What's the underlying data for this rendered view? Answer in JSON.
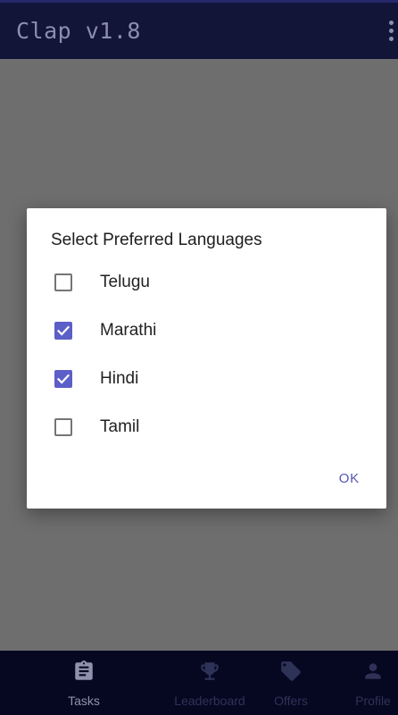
{
  "appbar": {
    "title": "Clap v1.8",
    "overflow_icon": "more-vert-icon"
  },
  "dialog": {
    "title": "Select Preferred Languages",
    "options": [
      {
        "label": "Telugu",
        "checked": false
      },
      {
        "label": "Marathi",
        "checked": true
      },
      {
        "label": "Hindi",
        "checked": true
      },
      {
        "label": "Tamil",
        "checked": false
      }
    ],
    "ok_label": "OK"
  },
  "bottom_nav": {
    "items": [
      {
        "label": "Tasks",
        "icon": "clipboard-icon",
        "active": true
      },
      {
        "label": "Leaderboard",
        "icon": "trophy-icon",
        "active": false
      },
      {
        "label": "Offers",
        "icon": "tag-icon",
        "active": false
      },
      {
        "label": "Profile",
        "icon": "person-icon",
        "active": false
      }
    ]
  },
  "colors": {
    "appbar_bg": "#121438",
    "accent": "#5b5fc7",
    "scrim": "#6e6e6e",
    "nav_bg": "#060821"
  }
}
